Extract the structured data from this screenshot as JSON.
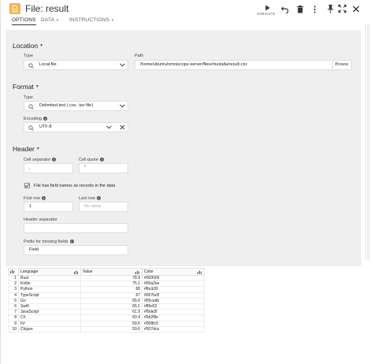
{
  "window": {
    "title": "File: result",
    "toolbar": {
      "execute_label": "EXECUTE"
    }
  },
  "tabs": [
    {
      "label": "OPTIONS",
      "active": true
    },
    {
      "label": "DATA",
      "active": false
    },
    {
      "label": "INSTRUCTIONS",
      "active": false
    }
  ],
  "location": {
    "title": "Location",
    "type_label": "Type",
    "type_value": "Local file",
    "path_label": "Path",
    "path_value": "/home/ubuntu/omniscope-server/files/mustafa/result.csv",
    "browse_label": "Browse"
  },
  "format": {
    "title": "Format",
    "type_label": "Type",
    "type_value": "Delimited text (.csv, .tsv file)",
    "encoding_label": "Encoding",
    "encoding_value": "UTF-8"
  },
  "header": {
    "title": "Header",
    "cell_separator_label": "Cell separator",
    "cell_separator_value": ",",
    "cell_quote_label": "Cell quote",
    "cell_quote_value": "\"",
    "field_names_label": "File has field names as records in the data",
    "field_names_checked": true,
    "first_row_label": "First row",
    "first_row_value": "1",
    "last_row_label": "Last row",
    "last_row_placeholder": "No value",
    "header_separator_label": "Header separator",
    "header_separator_value": "",
    "prefix_label": "Prefix for missing fields",
    "prefix_value": "Field"
  },
  "table": {
    "columns": [
      "Language",
      "Value",
      "Color"
    ],
    "rows": [
      [
        "1",
        "Rust",
        "78.9",
        "#000000"
      ],
      [
        "2",
        "Kotlin",
        "75.1",
        "#00a2ee"
      ],
      [
        "3",
        "Python",
        "68",
        "#fbcb39"
      ],
      [
        "4",
        "TypeScript",
        "67",
        "#007bc8"
      ],
      [
        "5",
        "Go",
        "65.6",
        "#65cedb"
      ],
      [
        "6",
        "Swift",
        "65.1",
        "#ff6e52"
      ],
      [
        "7",
        "JavaScript",
        "61.9",
        "#f9de3f"
      ],
      [
        "8",
        "C#",
        "60.4",
        "#5d2f8e"
      ],
      [
        "9",
        "F#",
        "59.6",
        "#008fc9"
      ],
      [
        "10",
        "Clojure",
        "59.6",
        "#507dca"
      ]
    ]
  },
  "icons": {
    "file": "file-icon",
    "execute": "play-icon",
    "undo": "undo-icon",
    "delete": "trash-icon",
    "more": "more-vertical-icon",
    "pin": "pin-icon",
    "expand": "expand-icon",
    "close": "close-icon"
  },
  "colors": {
    "file_icon": "#f3b24a",
    "options_bg": "#efefef"
  }
}
